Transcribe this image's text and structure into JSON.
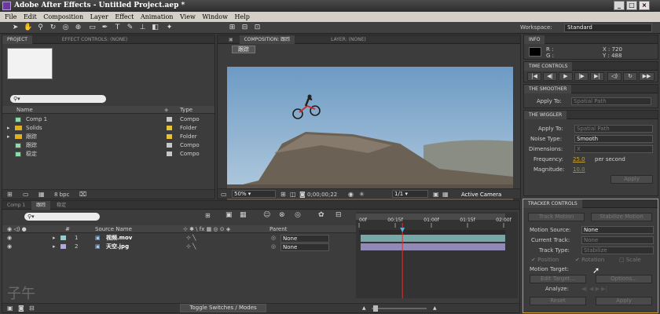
{
  "window": {
    "title": "Adobe After Effects - Untitled Project.aep *",
    "minimize": "_",
    "maximize": "□",
    "close": "×"
  },
  "menu": [
    "File",
    "Edit",
    "Composition",
    "Layer",
    "Effect",
    "Animation",
    "View",
    "Window",
    "Help"
  ],
  "toolbar": {
    "workspace_label": "Workspace:",
    "workspace_value": "Standard"
  },
  "project_panel": {
    "tabs": [
      "PROJECT",
      "EFFECT CONTROLS: (none)"
    ],
    "columns": {
      "name": "Name",
      "type": "Type"
    },
    "items": [
      {
        "name": "Comp 1",
        "type": "Compo",
        "kind": "comp",
        "color": "#c8c8c8"
      },
      {
        "name": "Solids",
        "type": "Folder",
        "kind": "folder",
        "color": "#e6c33a"
      },
      {
        "name": "跟踪",
        "type": "Folder",
        "kind": "folder",
        "color": "#e6c33a"
      },
      {
        "name": "跟踪",
        "type": "Compo",
        "kind": "comp",
        "color": "#c8c8c8"
      },
      {
        "name": "稳定",
        "type": "Compo",
        "kind": "comp",
        "color": "#c8c8c8"
      }
    ],
    "bpc": "8 bpc"
  },
  "comp_panel": {
    "tabs": [
      "COMPOSITION: 跟踪",
      "LAYER: (none)"
    ],
    "comp_tab": "跟踪",
    "zoom": "50%",
    "timecode": "0;00;00;22",
    "resolution": "1/1",
    "camera": "Active Camera"
  },
  "info_panel": {
    "title": "INFO",
    "r": "R :",
    "g": "G :",
    "x": "X : 720",
    "y": "Y : 488"
  },
  "time_controls": {
    "title": "TIME CONTROLS"
  },
  "smoother": {
    "title": "THE SMOOTHER",
    "apply_to_label": "Apply To:",
    "apply_to_value": "Spatial Path"
  },
  "wiggler": {
    "title": "THE WIGGLER",
    "apply_to_label": "Apply To:",
    "apply_to_value": "Spatial Path",
    "noise_label": "Noise Type:",
    "noise_value": "Smooth",
    "dimensions_label": "Dimensions:",
    "dimensions_value": "X",
    "frequency_label": "Frequency:",
    "frequency_value": "25.0",
    "frequency_unit": "per second",
    "magnitude_label": "Magnitude:",
    "magnitude_value": "10.0",
    "apply": "Apply"
  },
  "timeline": {
    "tabs": [
      "Comp 1",
      "跟踪",
      "稳定"
    ],
    "columns": {
      "num": "#",
      "source": "Source Name",
      "parent": "Parent"
    },
    "ruler": [
      "00f",
      "00:15f",
      "01:00f",
      "01:15f",
      "02:00f"
    ],
    "layers": [
      {
        "num": "1",
        "name": "视频.mov",
        "parent": "None",
        "label": "#8fd0d0"
      },
      {
        "num": "2",
        "name": "天空.jpg",
        "parent": "None",
        "label": "#b0a8e0"
      }
    ],
    "toggle": "Toggle Switches / Modes",
    "watermark": "子午"
  },
  "tracker": {
    "title": "TRACKER CONTROLS",
    "track_motion": "Track Motion",
    "stabilize_motion": "Stabilize Motion",
    "motion_source_label": "Motion Source:",
    "motion_source_value": "None",
    "current_track_label": "Current Track:",
    "current_track_value": "None",
    "track_type_label": "Track Type:",
    "track_type_value": "Stabilize",
    "position": "Position",
    "rotation": "Rotation",
    "scale": "Scale",
    "motion_target_label": "Motion Target:",
    "edit_target": "Edit Target...",
    "options": "Options...",
    "analyze_label": "Analyze:",
    "reset": "Reset",
    "apply": "Apply"
  }
}
